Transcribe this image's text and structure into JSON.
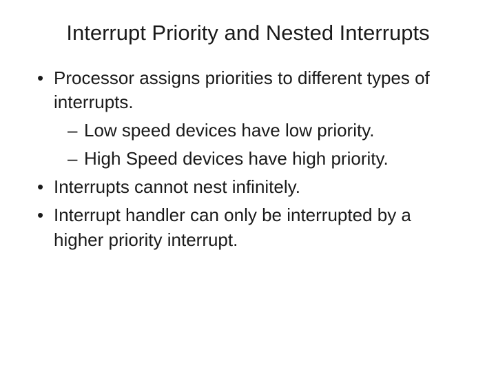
{
  "slide": {
    "title": "Interrupt Priority and Nested Interrupts",
    "bullets": [
      {
        "text": "Processor assigns priorities to different types of interrupts.",
        "sub": [
          "Low speed devices have low priority.",
          "High Speed devices have high priority."
        ]
      },
      {
        "text": "Interrupts cannot nest infinitely.",
        "sub": []
      },
      {
        "text": "Interrupt handler can only be interrupted by a higher priority interrupt.",
        "sub": []
      }
    ]
  }
}
